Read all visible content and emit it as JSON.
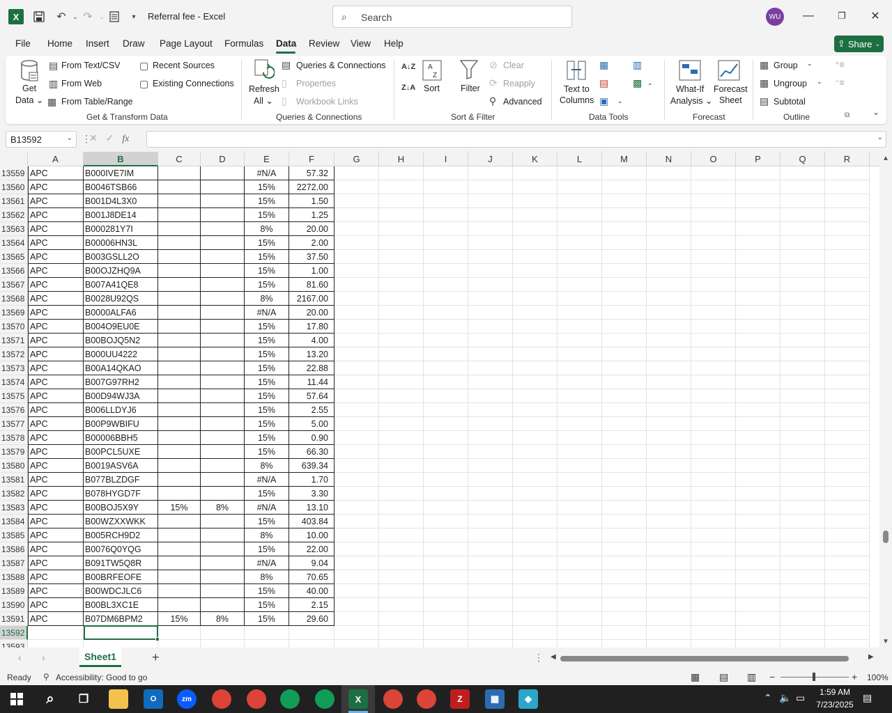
{
  "window": {
    "title": "Referral fee  -  Excel",
    "search_placeholder": "Search",
    "avatar_initials": "WU",
    "accent": "#1d6f42"
  },
  "menu": {
    "items": [
      "File",
      "Home",
      "Insert",
      "Draw",
      "Page Layout",
      "Formulas",
      "Data",
      "Review",
      "View",
      "Help"
    ],
    "active": "Data",
    "share_label": "Share"
  },
  "ribbon": {
    "get_data": "Get Data",
    "from_text_csv": "From Text/CSV",
    "from_web": "From Web",
    "from_table_range": "From Table/Range",
    "recent_sources": "Recent Sources",
    "existing_connections": "Existing Connections",
    "group_get_transform": "Get & Transform Data",
    "refresh_all": "Refresh All",
    "queries_connections": "Queries & Connections",
    "properties": "Properties",
    "workbook_links": "Workbook Links",
    "group_queries": "Queries & Connections",
    "sort": "Sort",
    "filter": "Filter",
    "clear": "Clear",
    "reapply": "Reapply",
    "advanced": "Advanced",
    "group_sort_filter": "Sort & Filter",
    "text_to_columns": "Text to Columns",
    "group_data_tools": "Data Tools",
    "what_if": "What-If Analysis",
    "forecast_sheet": "Forecast Sheet",
    "group_forecast": "Forecast",
    "group": "Group",
    "ungroup": "Ungroup",
    "subtotal": "Subtotal",
    "group_outline": "Outline"
  },
  "formula_bar": {
    "name_box": "B13592",
    "fx": "fx",
    "formula": ""
  },
  "columns": [
    "A",
    "B",
    "C",
    "D",
    "E",
    "F",
    "G",
    "H",
    "I",
    "J",
    "K",
    "L",
    "M",
    "N",
    "O",
    "P",
    "Q",
    "R"
  ],
  "selected_column": "B",
  "rows": [
    {
      "n": "13559",
      "a": "APC",
      "b": "B000IVE7IM",
      "c": "",
      "d": "",
      "e": "#N/A",
      "f": "57.32"
    },
    {
      "n": "13560",
      "a": "APC",
      "b": "B0046TSB66",
      "c": "",
      "d": "",
      "e": "15%",
      "f": "2272.00"
    },
    {
      "n": "13561",
      "a": "APC",
      "b": "B001D4L3X0",
      "c": "",
      "d": "",
      "e": "15%",
      "f": "1.50"
    },
    {
      "n": "13562",
      "a": "APC",
      "b": "B001J8DE14",
      "c": "",
      "d": "",
      "e": "15%",
      "f": "1.25"
    },
    {
      "n": "13563",
      "a": "APC",
      "b": "B000281Y7I",
      "c": "",
      "d": "",
      "e": "8%",
      "f": "20.00"
    },
    {
      "n": "13564",
      "a": "APC",
      "b": "B00006HN3L",
      "c": "",
      "d": "",
      "e": "15%",
      "f": "2.00"
    },
    {
      "n": "13565",
      "a": "APC",
      "b": "B003GSLL2O",
      "c": "",
      "d": "",
      "e": "15%",
      "f": "37.50"
    },
    {
      "n": "13566",
      "a": "APC",
      "b": "B00OJZHQ9A",
      "c": "",
      "d": "",
      "e": "15%",
      "f": "1.00"
    },
    {
      "n": "13567",
      "a": "APC",
      "b": "B007A41QE8",
      "c": "",
      "d": "",
      "e": "15%",
      "f": "81.60"
    },
    {
      "n": "13568",
      "a": "APC",
      "b": "B0028U92QS",
      "c": "",
      "d": "",
      "e": "8%",
      "f": "2167.00"
    },
    {
      "n": "13569",
      "a": "APC",
      "b": "B0000ALFA6",
      "c": "",
      "d": "",
      "e": "#N/A",
      "f": "20.00"
    },
    {
      "n": "13570",
      "a": "APC",
      "b": "B004O9EU0E",
      "c": "",
      "d": "",
      "e": "15%",
      "f": "17.80"
    },
    {
      "n": "13571",
      "a": "APC",
      "b": "B00BOJQ5N2",
      "c": "",
      "d": "",
      "e": "15%",
      "f": "4.00"
    },
    {
      "n": "13572",
      "a": "APC",
      "b": "B000UU4222",
      "c": "",
      "d": "",
      "e": "15%",
      "f": "13.20"
    },
    {
      "n": "13573",
      "a": "APC",
      "b": "B00A14QKAO",
      "c": "",
      "d": "",
      "e": "15%",
      "f": "22.88"
    },
    {
      "n": "13574",
      "a": "APC",
      "b": "B007G97RH2",
      "c": "",
      "d": "",
      "e": "15%",
      "f": "11.44"
    },
    {
      "n": "13575",
      "a": "APC",
      "b": "B00D94WJ3A",
      "c": "",
      "d": "",
      "e": "15%",
      "f": "57.64"
    },
    {
      "n": "13576",
      "a": "APC",
      "b": "B006LLDYJ6",
      "c": "",
      "d": "",
      "e": "15%",
      "f": "2.55"
    },
    {
      "n": "13577",
      "a": "APC",
      "b": "B00P9WBIFU",
      "c": "",
      "d": "",
      "e": "15%",
      "f": "5.00"
    },
    {
      "n": "13578",
      "a": "APC",
      "b": "B00006BBH5",
      "c": "",
      "d": "",
      "e": "15%",
      "f": "0.90"
    },
    {
      "n": "13579",
      "a": "APC",
      "b": "B00PCL5UXE",
      "c": "",
      "d": "",
      "e": "15%",
      "f": "66.30"
    },
    {
      "n": "13580",
      "a": "APC",
      "b": "B0019ASV6A",
      "c": "",
      "d": "",
      "e": "8%",
      "f": "639.34"
    },
    {
      "n": "13581",
      "a": "APC",
      "b": "B077BLZDGF",
      "c": "",
      "d": "",
      "e": "#N/A",
      "f": "1.70"
    },
    {
      "n": "13582",
      "a": "APC",
      "b": "B078HYGD7F",
      "c": "",
      "d": "",
      "e": "15%",
      "f": "3.30"
    },
    {
      "n": "13583",
      "a": "APC",
      "b": "B00BOJ5X9Y",
      "c": "15%",
      "d": "8%",
      "e": "#N/A",
      "f": "13.10"
    },
    {
      "n": "13584",
      "a": "APC",
      "b": "B00WZXXWKK",
      "c": "",
      "d": "",
      "e": "15%",
      "f": "403.84"
    },
    {
      "n": "13585",
      "a": "APC",
      "b": "B005RCH9D2",
      "c": "",
      "d": "",
      "e": "8%",
      "f": "10.00"
    },
    {
      "n": "13586",
      "a": "APC",
      "b": "B0076Q0YQG",
      "c": "",
      "d": "",
      "e": "15%",
      "f": "22.00"
    },
    {
      "n": "13587",
      "a": "APC",
      "b": "B091TW5Q8R",
      "c": "",
      "d": "",
      "e": "#N/A",
      "f": "9.04"
    },
    {
      "n": "13588",
      "a": "APC",
      "b": "B00BRFEOFE",
      "c": "",
      "d": "",
      "e": "8%",
      "f": "70.65"
    },
    {
      "n": "13589",
      "a": "APC",
      "b": "B00WDCJLC6",
      "c": "",
      "d": "",
      "e": "15%",
      "f": "40.00"
    },
    {
      "n": "13590",
      "a": "APC",
      "b": "B00BL3XC1E",
      "c": "",
      "d": "",
      "e": "15%",
      "f": "2.15"
    },
    {
      "n": "13591",
      "a": "APC",
      "b": "B07DM6BPM2",
      "c": "15%",
      "d": "8%",
      "e": "15%",
      "f": "29.60"
    },
    {
      "n": "13592",
      "a": "",
      "b": "",
      "c": "",
      "d": "",
      "e": "",
      "f": ""
    },
    {
      "n": "13593",
      "a": "",
      "b": "",
      "c": "",
      "d": "",
      "e": "",
      "f": ""
    }
  ],
  "sheet": {
    "tab": "Sheet1",
    "add": "+"
  },
  "status": {
    "ready": "Ready",
    "accessibility": "Accessibility: Good to go",
    "zoom": "100%"
  },
  "taskbar": {
    "time": "1:59 AM",
    "date": "7/23/2025"
  }
}
